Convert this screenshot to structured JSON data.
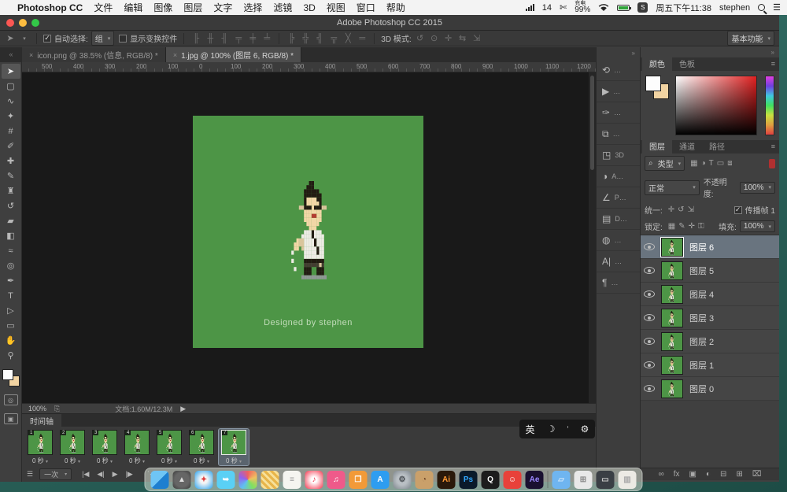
{
  "menubar": {
    "apple": "",
    "app_name": "Photoshop CC",
    "items": [
      "文件",
      "编辑",
      "图像",
      "图层",
      "文字",
      "选择",
      "滤镜",
      "3D",
      "视图",
      "窗口",
      "帮助"
    ],
    "status": {
      "signal": "14",
      "battery_state": "充电",
      "battery_pct": "99%",
      "ime": "S",
      "time": "周五下午11:38",
      "user": "stephen",
      "list_icon": "☰",
      "scissors_icon": "✄"
    }
  },
  "window": {
    "title": "Adobe Photoshop CC 2015"
  },
  "options_bar": {
    "move_tool_icon": "➤",
    "caret": "▾",
    "auto_select_label": "自动选择:",
    "auto_select_value": "组",
    "auto_select_checked": "✓",
    "show_transform_label": "显示变换控件",
    "align_icons": [
      "╟",
      "╫",
      "╢",
      "╤",
      "╪",
      "╧"
    ],
    "distribute_icons": [
      "╠",
      "╬",
      "╣",
      "╦",
      "╳",
      "═"
    ],
    "mode3d_label": "3D 模式:",
    "mode3d_icons": [
      "↺",
      "⊙",
      "✛",
      "⇆",
      "⇲"
    ],
    "workspace": "基本功能"
  },
  "tabs": [
    {
      "close": "×",
      "title": "icon.png @ 38.5% (信息, RGB/8) *",
      "active": false
    },
    {
      "close": "×",
      "title": "1.jpg @ 100% (图层 6, RGB/8) *",
      "active": true
    }
  ],
  "tab_corner": "«",
  "ruler_labels": [
    "500",
    "400",
    "300",
    "200",
    "100",
    "0",
    "100",
    "200",
    "300",
    "400",
    "500",
    "600",
    "700",
    "800",
    "900",
    "1000",
    "1100",
    "1200"
  ],
  "toolbar": {
    "tools": [
      {
        "name": "move-tool",
        "glyph": "➤",
        "selected": true
      },
      {
        "name": "marquee-tool",
        "glyph": "▢",
        "selected": false
      },
      {
        "name": "lasso-tool",
        "glyph": "∿",
        "selected": false
      },
      {
        "name": "magic-wand-tool",
        "glyph": "✦",
        "selected": false
      },
      {
        "name": "crop-tool",
        "glyph": "#",
        "selected": false
      },
      {
        "name": "eyedropper-tool",
        "glyph": "✐",
        "selected": false
      },
      {
        "name": "healing-brush-tool",
        "glyph": "✚",
        "selected": false
      },
      {
        "name": "brush-tool",
        "glyph": "✎",
        "selected": false
      },
      {
        "name": "clone-stamp-tool",
        "glyph": "♜",
        "selected": false
      },
      {
        "name": "history-brush-tool",
        "glyph": "↺",
        "selected": false
      },
      {
        "name": "eraser-tool",
        "glyph": "▰",
        "selected": false
      },
      {
        "name": "gradient-tool",
        "glyph": "◧",
        "selected": false
      },
      {
        "name": "blur-tool",
        "glyph": "≈",
        "selected": false
      },
      {
        "name": "dodge-tool",
        "glyph": "◎",
        "selected": false
      },
      {
        "name": "pen-tool",
        "glyph": "✒",
        "selected": false
      },
      {
        "name": "type-tool",
        "glyph": "T",
        "selected": false
      },
      {
        "name": "path-select-tool",
        "glyph": "▷",
        "selected": false
      },
      {
        "name": "shape-tool",
        "glyph": "▭",
        "selected": false
      },
      {
        "name": "hand-tool",
        "glyph": "✋",
        "selected": false
      },
      {
        "name": "zoom-tool",
        "glyph": "⚲",
        "selected": false
      }
    ]
  },
  "canvas": {
    "bg": "#4d9546",
    "caption": "Designed by stephen",
    "pixel_art": {
      "palette": {
        "K": "#221b12",
        "S": "#f2d7a6",
        "W": "#edebe4",
        "C": "#d9c59c",
        "R": "#b23c31",
        "D": "#423c30",
        "G": "#8f9894"
      },
      "rows": [
        ".......KK.....",
        "......KKK.....",
        ".....KKKKKK...",
        ".....KKKKKKK..",
        ".....KSSSSKK..",
        ".....KSSSSSK..",
        "...CCKKKSKKKCC",
        ".....SSSSSSS..",
        ".....SSSRRSS..",
        ".....SSSSSSS..",
        "......SSSSS...",
        ".......SSS....",
        ".....WWWKWWW..",
        "....WWWWKWWWW.",
        "..SCCWWWWKWWW.",
        ".SSCCWWWWKWWW.",
        ".SS.CWWWWWKWW.",
        "W....WWWWWKWW.",
        ".....WWWWWWWW.",
        "W....KKKKKKKK.",
        ".....DDDDDDCD.",
        ".W...KKK..KKK.",
        ".....KKK..KKK.",
        "....GGGGGGGGGG"
      ]
    }
  },
  "status_bar": {
    "zoom": "100%",
    "export_icon": "⎘",
    "doc_info": "文档:1.60M/12.3M",
    "play_icon": "▶"
  },
  "timeline": {
    "title": "时间轴",
    "frames": [
      {
        "n": "1",
        "delay": "0 秒"
      },
      {
        "n": "2",
        "delay": "0 秒"
      },
      {
        "n": "3",
        "delay": "0 秒"
      },
      {
        "n": "4",
        "delay": "0 秒"
      },
      {
        "n": "5",
        "delay": "0 秒"
      },
      {
        "n": "6",
        "delay": "0 秒"
      },
      {
        "n": "7",
        "delay": "0 秒"
      }
    ],
    "selected_frame": 6,
    "options_icon": "☰",
    "loop_label": "一次",
    "transport_icons": [
      "|◀",
      "◀|",
      "▶",
      "|▶"
    ],
    "extra_icons": [
      "⋱",
      "⊞",
      "⌧"
    ]
  },
  "panel_strip": {
    "collapse": "»",
    "items": [
      {
        "name": "history-icon",
        "glyph": "⟲",
        "label": "…"
      },
      {
        "name": "actions-icon",
        "glyph": "▶",
        "label": "…"
      },
      {
        "name": "brush-settings-icon",
        "glyph": "✑",
        "label": "…"
      },
      {
        "name": "clone-source-icon",
        "glyph": "⧉",
        "label": "…"
      },
      {
        "name": "3d-icon",
        "glyph": "◳",
        "label": "3D"
      },
      {
        "name": "adjustments-icon",
        "glyph": "◑",
        "label": "A…"
      },
      {
        "name": "properties-icon",
        "glyph": "∠",
        "label": "P…"
      },
      {
        "name": "libraries-icon",
        "glyph": "▤",
        "label": "D…"
      },
      {
        "name": "info-icon",
        "glyph": "◍",
        "label": "…"
      },
      {
        "name": "character-icon",
        "glyph": "A|",
        "label": "…"
      },
      {
        "name": "paragraph-icon",
        "glyph": "¶",
        "label": "…"
      }
    ]
  },
  "panels": {
    "collapse": "»",
    "color_tabs": [
      "颜色",
      "色板"
    ],
    "panel_menu_icon": "≡",
    "layer_tabs": [
      "图层",
      "通道",
      "路径"
    ],
    "kind_search_icon": "⌕",
    "kind_label": "类型",
    "kind_filter_icons": [
      "▦",
      "◑",
      "T",
      "▭",
      "⧈"
    ],
    "blend_mode": "正常",
    "opacity_label": "不透明度:",
    "opacity_value": "100%",
    "unify_label": "统一:",
    "unify_icons": [
      "✛",
      "↺",
      "⇲"
    ],
    "propagate_checked": "✓",
    "propagate_label": "传播帧 1",
    "lock_label": "锁定:",
    "lock_icons": [
      "▦",
      "✎",
      "✛",
      "⚿"
    ],
    "fill_label": "填充:",
    "fill_value": "100%",
    "layers": [
      "图层 6",
      "图层 5",
      "图层 4",
      "图层 3",
      "图层 2",
      "图层 1",
      "图层 0"
    ],
    "selected_layer": 0,
    "footer_icons": [
      "∞",
      "fx",
      "▣",
      "◐",
      "⊟",
      "⊞",
      "⌧"
    ]
  },
  "ime_pill": {
    "lang": "英",
    "moon_icon": "☽",
    "mark": "’",
    "gear_icon": "⚙"
  },
  "dock": {
    "items": [
      {
        "name": "finder-icon",
        "bg": "linear-gradient(135deg,#6fc5f5 50%,#1e7fd0 50%)",
        "glyph": "",
        "fg": "#fff"
      },
      {
        "name": "launchpad-icon",
        "bg": "radial-gradient(circle,#666 55%,#3a3a3a)",
        "glyph": "▲",
        "fg": "#ddd"
      },
      {
        "name": "safari-icon",
        "bg": "radial-gradient(circle,#f5f5f5 28%,#2aa3ef)",
        "glyph": "✦",
        "fg": "#e04040"
      },
      {
        "name": "blue-bird-app-icon",
        "bg": "#5ad0f5",
        "glyph": "➥",
        "fg": "#fff"
      },
      {
        "name": "photos-icon",
        "bg": "conic-gradient(#f06060,#f0c060,#80e060,#60c0f0,#9060f0,#f06060)",
        "glyph": "",
        "fg": "#fff"
      },
      {
        "name": "notes-grid-icon",
        "bg": "repeating-linear-gradient(45deg,#e8b54a 0 3px,#f7e09a 3px 6px)",
        "glyph": "",
        "fg": "#fff"
      },
      {
        "name": "textedit-icon",
        "bg": "#f5f5f0",
        "glyph": "≡",
        "fg": "#999"
      },
      {
        "name": "itunes-icon",
        "bg": "radial-gradient(circle,#fff 22%,#f4374f)",
        "glyph": "♪",
        "fg": "#f4374f"
      },
      {
        "name": "music-icon",
        "bg": "#ef5a8a",
        "glyph": "♫",
        "fg": "#fff"
      },
      {
        "name": "books-icon",
        "bg": "#f29a38",
        "glyph": "❐",
        "fg": "#fff"
      },
      {
        "name": "app-store-icon",
        "bg": "#2e9df0",
        "glyph": "A",
        "fg": "#fff"
      },
      {
        "name": "system-preferences-icon",
        "bg": "radial-gradient(circle,#b9bfc4 40%,#7d858c)",
        "glyph": "⚙",
        "fg": "#4a4f54"
      },
      {
        "name": "monkey-app-icon",
        "bg": "#caa06a",
        "glyph": "◔",
        "fg": "#6d4526"
      },
      {
        "name": "illustrator-icon",
        "bg": "#2a190a",
        "glyph": "Ai",
        "fg": "#ff9a33"
      },
      {
        "name": "photoshop-icon",
        "bg": "#0a1a2a",
        "glyph": "Ps",
        "fg": "#31a8ff"
      },
      {
        "name": "qq-icon",
        "bg": "#1c1c1c",
        "glyph": "Q",
        "fg": "#fff"
      },
      {
        "name": "red-character-app-icon",
        "bg": "#e8413a",
        "glyph": "☺",
        "fg": "#fff"
      },
      {
        "name": "after-effects-icon",
        "bg": "#1a1030",
        "glyph": "Ae",
        "fg": "#9a86ff"
      },
      {
        "name": "separator",
        "bg": "",
        "glyph": "",
        "fg": ""
      },
      {
        "name": "folder-icon",
        "bg": "#6fb5f0",
        "glyph": "▱",
        "fg": "#cfe6fa"
      },
      {
        "name": "downloads-grid-icon",
        "bg": "#e8e8e8",
        "glyph": "⊞",
        "fg": "#888"
      },
      {
        "name": "display-window-icon",
        "bg": "#3a3f45",
        "glyph": "▭",
        "fg": "#ccc"
      },
      {
        "name": "trash-icon",
        "bg": "#eceae4",
        "glyph": "▥",
        "fg": "#a8a8a8"
      }
    ]
  }
}
